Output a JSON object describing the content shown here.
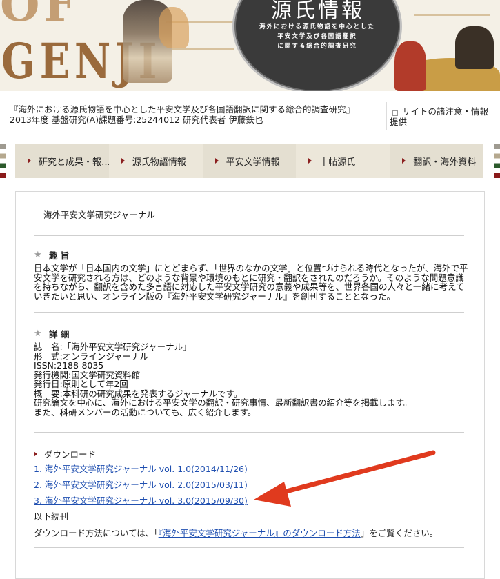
{
  "banner": {
    "logo_line1": "OF",
    "logo_line2": "GENJI",
    "seal_title": "源氏情報",
    "seal_lines": [
      "海外における源氏物語を中心とした",
      "平安文学及び各国語翻訳",
      "に関する総合的調査研究"
    ]
  },
  "project": {
    "line1": "『海外における源氏物語を中心とした平安文学及び各国語翻訳に関する総合的調査研究』",
    "line2": "2013年度 基盤研究(A)課題番号:25244012 研究代表者 伊藤鉄也"
  },
  "notice_link": "サイトの諸注意・情報提供",
  "nav": [
    {
      "label": "研究と成果・報…"
    },
    {
      "label": "源氏物語情報"
    },
    {
      "label": "平安文学情報"
    },
    {
      "label": "十帖源氏"
    },
    {
      "label": "翻訳・海外資料"
    }
  ],
  "main": {
    "journal_title": "海外平安文学研究ジャーナル",
    "purpose_heading": "趣 旨",
    "purpose_text": "日本文学が「日本国内の文学」にとどまらず、「世界のなかの文学」と位置づけられる時代となったが、海外で平安文学を研究される方は、どのような背景や環境のもとに研究・翻訳をされたのだろうか。そのような問題意識を持ちながら、翻訳を含めた多言語に対応した平安文学研究の意義や成果等を、世界各国の人々と一緒に考えていきたいと思い、オンライン版の『海外平安文学研究ジャーナル』を創刊することとなった。",
    "details_heading": "詳 細",
    "details": [
      "誌　名:「海外平安文学研究ジャーナル」",
      "形　式:オンラインジャーナル",
      "ISSN:2188-8035",
      "発行機関:国文学研究資料館",
      "発行日:原則として年2回",
      "概　要:本科研の研究成果を発表するジャーナルです。",
      "研究論文を中心に、海外における平安文学の翻訳・研究事情、最新翻訳書の紹介等を掲載します。",
      "また、科研メンバーの活動についても、広く紹介します。"
    ],
    "download_heading": "ダウンロード",
    "downloads": [
      {
        "label": "1. 海外平安文学研究ジャーナル vol. 1.0(2014/11/26)"
      },
      {
        "label": "2. 海外平安文学研究ジャーナル vol. 2.0(2015/03/11)"
      },
      {
        "label": "3. 海外平安文学研究ジャーナル vol. 3.0(2015/09/30)"
      }
    ],
    "continued": "以下続刊",
    "method_prefix": "ダウンロード方法については、「",
    "method_link": "『海外平安文学研究ジャーナル』のダウンロード方法",
    "method_suffix": "」をご覧ください。"
  },
  "colors": {
    "link": "#1f4fb0",
    "nav_bg": "#e9e4d6",
    "accent_red": "#e03a1e",
    "arrow_marker": "#8b1f1f"
  },
  "icons": {
    "section_marker": "star-icon",
    "nav_marker": "triangle-right-icon",
    "annotation": "red-arrow-annotation"
  }
}
